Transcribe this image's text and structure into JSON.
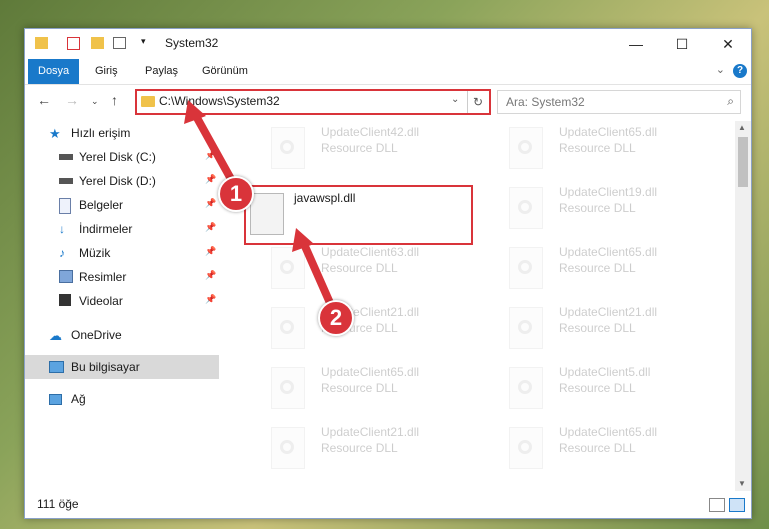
{
  "window": {
    "title": "System32"
  },
  "ribbon": {
    "tabs": [
      "Dosya",
      "Giriş",
      "Paylaş",
      "Görünüm"
    ]
  },
  "address": {
    "path": "C:\\Windows\\System32"
  },
  "search": {
    "placeholder": "Ara: System32"
  },
  "sidebar": {
    "items": [
      {
        "label": "Hızlı erişim",
        "icon": "star-icon"
      },
      {
        "label": "Yerel Disk (C:)",
        "icon": "drive-icon",
        "pinned": true
      },
      {
        "label": "Yerel Disk (D:)",
        "icon": "drive-icon",
        "pinned": true
      },
      {
        "label": "Belgeler",
        "icon": "documents-icon",
        "pinned": true
      },
      {
        "label": "İndirmeler",
        "icon": "downloads-icon",
        "pinned": true
      },
      {
        "label": "Müzik",
        "icon": "music-icon",
        "pinned": true
      },
      {
        "label": "Resimler",
        "icon": "pictures-icon",
        "pinned": true
      },
      {
        "label": "Videolar",
        "icon": "videos-icon",
        "pinned": true
      },
      {
        "label": "OneDrive",
        "icon": "cloud-icon"
      },
      {
        "label": "Bu bilgisayar",
        "icon": "computer-icon",
        "selected": true
      },
      {
        "label": "Ağ",
        "icon": "network-icon"
      }
    ]
  },
  "files": [
    {
      "name": "UpdateClient42.dll",
      "type": "Resource DLL"
    },
    {
      "name": "UpdateClient65.dll",
      "type": "Resource DLL"
    },
    {
      "name": "javawspl.dll",
      "type": ""
    },
    {
      "name": "UpdateClient19.dll",
      "type": "Resource DLL"
    },
    {
      "name": "UpdateClient63.dll",
      "type": "Resource DLL"
    },
    {
      "name": "UpdateClient65.dll",
      "type": "Resource DLL"
    },
    {
      "name": "UpdateClient21.dll",
      "type": "Resource DLL"
    },
    {
      "name": "UpdateClient21.dll",
      "type": "Resource DLL"
    },
    {
      "name": "UpdateClient65.dll",
      "type": "Resource DLL"
    },
    {
      "name": "UpdateClient5.dll",
      "type": "Resource DLL"
    },
    {
      "name": "UpdateClient21.dll",
      "type": "Resource DLL"
    },
    {
      "name": "UpdateClient65.dll",
      "type": "Resource DLL"
    }
  ],
  "status": {
    "count": "111 öğe"
  },
  "callouts": [
    "1",
    "2"
  ],
  "colors": {
    "accent": "#1979ca",
    "highlight": "#d9343a"
  }
}
